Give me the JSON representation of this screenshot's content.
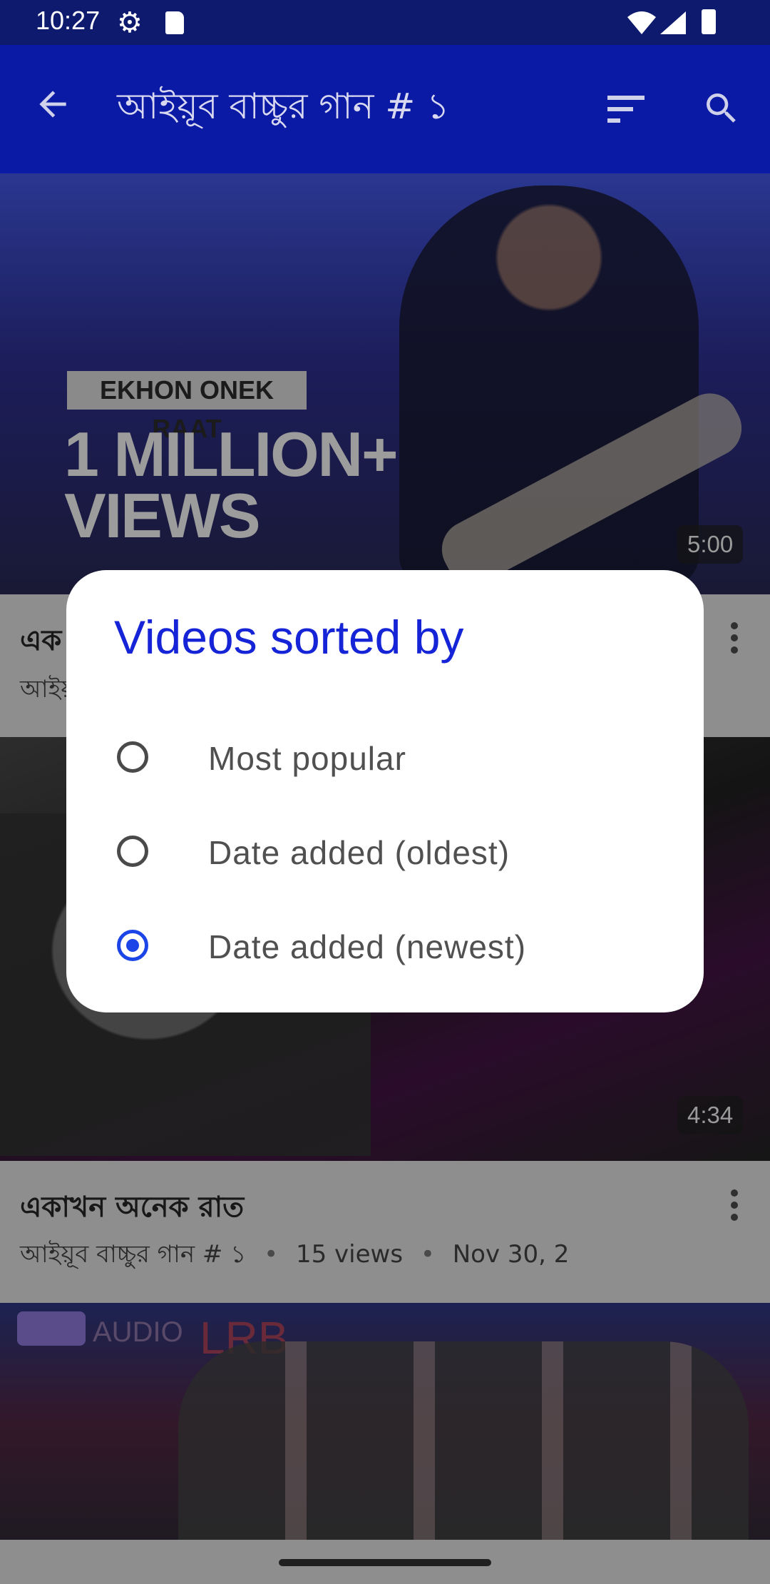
{
  "status_bar": {
    "time": "10:27",
    "icons": [
      "gear-icon",
      "sd-card-icon",
      "wifi-icon",
      "signal-icon",
      "battery-icon"
    ]
  },
  "app_bar": {
    "title": "আইয়ূব বাচ্চুর গান # ১",
    "icons": [
      "back-arrow-icon",
      "sort-icon",
      "search-icon"
    ]
  },
  "videos": [
    {
      "thumbnail_text_top": "EKHON ONEK RAAT",
      "thumbnail_text_big": "1 MILLION+\nVIEWS",
      "duration": "5:00",
      "title": "এক",
      "meta_channel": "আইয়"
    },
    {
      "duration": "4:34",
      "title": "একাখন অনেক রাত",
      "meta_channel": "আইয়ূব বাচ্চুর গান # ১",
      "meta_views": "15 views",
      "meta_date": "Nov 30, 2"
    },
    {
      "thumbnail_text_audio": "AUDIO",
      "thumbnail_text_lrb": "LRB"
    }
  ],
  "dialog": {
    "title": "Videos sorted by",
    "options": [
      {
        "label": "Most popular",
        "selected": false
      },
      {
        "label": "Date added (oldest)",
        "selected": false
      },
      {
        "label": "Date added (newest)",
        "selected": true
      }
    ],
    "accent_color": "#1b45e6"
  },
  "colors": {
    "status_bar": "#0d1a6e",
    "app_bar": "#0b1aa5",
    "scrim": "#8e8e8e",
    "dialog_title": "#1424d6"
  }
}
